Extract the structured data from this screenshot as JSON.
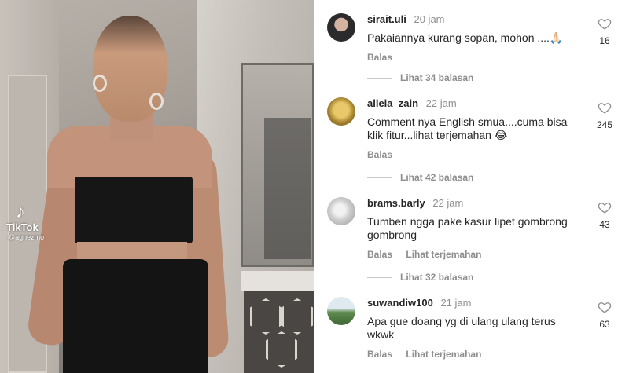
{
  "video": {
    "watermark_icon": "tiktok-logo-icon",
    "watermark_brand": "TikTok",
    "watermark_user": "@agnezmo"
  },
  "comments": [
    {
      "username": "sirait.uli",
      "time": "20 jam",
      "text": "Pakaiannya kurang sopan, mohon ....🙏🏻",
      "actions": [
        "Balas"
      ],
      "likes": "16",
      "avatar_color": "#2b2a2c"
    },
    {
      "username": "alleia_zain",
      "time": "22 jam",
      "text": "Comment nya English smua....cuma bisa klik fitur...lihat terjemahan 😂",
      "actions": [
        "Balas"
      ],
      "likes": "245",
      "avatar_color": "#c8a247"
    },
    {
      "username": "brams.barly",
      "time": "22 jam",
      "text": "Tumben ngga pake kasur lipet gombrong gombrong",
      "actions": [
        "Balas",
        "Lihat terjemahan"
      ],
      "likes": "43",
      "avatar_color": "#bdbdbd"
    },
    {
      "username": "suwandiw100",
      "time": "21 jam",
      "text": "Apa gue doang yg di ulang ulang terus wkwk",
      "actions": [
        "Balas",
        "Lihat terjemahan"
      ],
      "likes": "63",
      "avatar_color": "#5f8a4e"
    }
  ],
  "view_replies": [
    "Lihat 34 balasan",
    "Lihat 42 balasan",
    "Lihat 32 balasan"
  ],
  "icons": {
    "like": "heart-outline-icon"
  }
}
